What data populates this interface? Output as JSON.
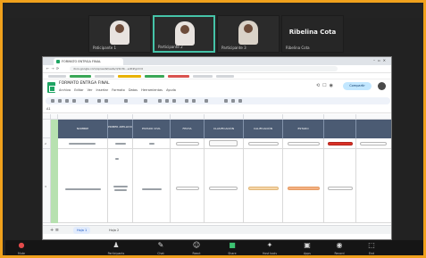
{
  "participants": [
    {
      "name": "Paticipante 1"
    },
    {
      "name": "Participante 2"
    },
    {
      "name": "Participante 3"
    },
    {
      "name": "Ribelina Cota",
      "display_text": "Ribelina Cota"
    }
  ],
  "browser": {
    "tab_title": "FORMATO ENTRGA FINAL",
    "url": "docs.google.com/spreadsheets/d/1k3b...edit#gid=0"
  },
  "sheet": {
    "title": "FORMATO ENTRGA FINAL",
    "menu": "Archivo  Editar  Ver  Insertar  Formato  Datos  Herramientas  Ayuda",
    "share_label": "Compartir",
    "cell_ref": "A1",
    "headers": [
      "",
      "NOMBRE",
      "PRIMER APELLIDO",
      "ESTADO CIVIL",
      "FECHA",
      "CLASIFICACIÓN",
      "CALIFICACIÓN",
      "ESTADO",
      ""
    ],
    "row_numbers": [
      "1",
      "2",
      "3"
    ],
    "tabs": [
      "Hoja 1",
      "Hoja 2"
    ]
  },
  "zoom_bar": {
    "items": [
      {
        "icon": "mic-off-icon",
        "label": "Mute"
      },
      {
        "icon": "participants-icon",
        "label": "Participants"
      },
      {
        "icon": "chat-icon",
        "label": "Chat"
      },
      {
        "icon": "react-icon",
        "label": "React"
      },
      {
        "icon": "share-icon",
        "label": "Share"
      },
      {
        "icon": "host-tools-icon",
        "label": "Host tools"
      },
      {
        "icon": "apps-icon",
        "label": "Apps"
      },
      {
        "icon": "record-icon",
        "label": "Record"
      },
      {
        "icon": "end-icon",
        "label": "End"
      }
    ]
  },
  "colors": {
    "active_speaker_border": "#45c3a8",
    "outer_border": "#f0a11c",
    "header_fill": "#4b5b73",
    "status_red": "#d93025"
  }
}
